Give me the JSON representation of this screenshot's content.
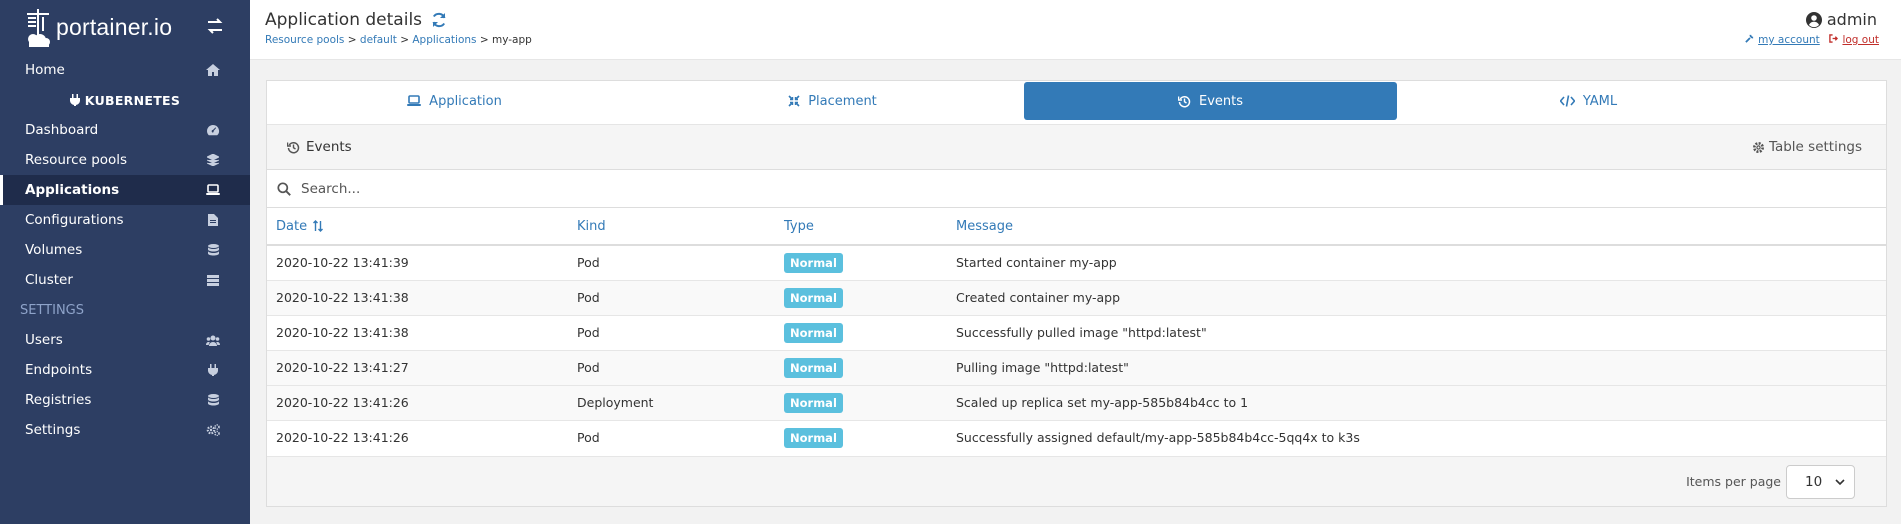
{
  "brand": {
    "name": "portainer.io"
  },
  "sidebar": {
    "items": [
      {
        "label": "Home",
        "icon": "home-icon"
      },
      {
        "label": "KUBERNETES",
        "icon": "plug-icon"
      },
      {
        "label": "Dashboard",
        "icon": "dashboard-icon"
      },
      {
        "label": "Resource pools",
        "icon": "layers-icon"
      },
      {
        "label": "Applications",
        "icon": "laptop-icon"
      },
      {
        "label": "Configurations",
        "icon": "file-icon"
      },
      {
        "label": "Volumes",
        "icon": "database-icon"
      },
      {
        "label": "Cluster",
        "icon": "server-icon"
      },
      {
        "label": "SETTINGS"
      },
      {
        "label": "Users",
        "icon": "users-icon"
      },
      {
        "label": "Endpoints",
        "icon": "plug-icon"
      },
      {
        "label": "Registries",
        "icon": "database-icon"
      },
      {
        "label": "Settings",
        "icon": "cogs-icon"
      }
    ]
  },
  "header": {
    "title": "Application details",
    "breadcrumb": [
      "Resource pools",
      "default",
      "Applications",
      "my-app"
    ],
    "breadcrumb_sep": ">",
    "user": "admin",
    "my_account": "my account",
    "log_out": "log out"
  },
  "tabs": [
    {
      "label": "Application",
      "icon": "laptop-icon",
      "active": false
    },
    {
      "label": "Placement",
      "icon": "compress-icon",
      "active": false
    },
    {
      "label": "Events",
      "icon": "history-icon",
      "active": true
    },
    {
      "label": "YAML",
      "icon": "code-icon",
      "active": false
    }
  ],
  "widget": {
    "title": "Events",
    "table_settings": "Table settings",
    "search_placeholder": "Search...",
    "columns": [
      "Date",
      "Kind",
      "Type",
      "Message"
    ],
    "rows": [
      {
        "date": "2020-10-22 13:41:39",
        "kind": "Pod",
        "type": "Normal",
        "message": "Started container my-app"
      },
      {
        "date": "2020-10-22 13:41:38",
        "kind": "Pod",
        "type": "Normal",
        "message": "Created container my-app"
      },
      {
        "date": "2020-10-22 13:41:38",
        "kind": "Pod",
        "type": "Normal",
        "message": "Successfully pulled image \"httpd:latest\""
      },
      {
        "date": "2020-10-22 13:41:27",
        "kind": "Pod",
        "type": "Normal",
        "message": "Pulling image \"httpd:latest\""
      },
      {
        "date": "2020-10-22 13:41:26",
        "kind": "Deployment",
        "type": "Normal",
        "message": "Scaled up replica set my-app-585b84b4cc to 1"
      },
      {
        "date": "2020-10-22 13:41:26",
        "kind": "Pod",
        "type": "Normal",
        "message": "Successfully assigned default/my-app-585b84b4cc-5qq4x to k3s"
      }
    ],
    "items_per_page_label": "Items per page",
    "items_per_page": "10"
  },
  "colors": {
    "sidebar": "#2d3e63",
    "primary": "#337ab7",
    "badge": "#5bc0de"
  }
}
